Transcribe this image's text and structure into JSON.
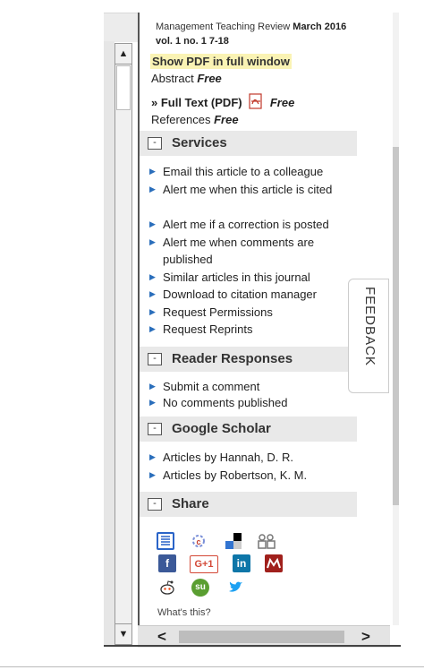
{
  "citation": {
    "journal": "Management Teaching Review",
    "date": "March 2016",
    "vol": "vol. 1 no. 1 7-18"
  },
  "pdf_window_link": "Show PDF in full window",
  "abstract": {
    "label": "Abstract",
    "free": "Free"
  },
  "fulltext": {
    "label": "» Full Text (PDF)",
    "free": "Free"
  },
  "references": {
    "label": "References",
    "free": "Free"
  },
  "services": {
    "title": "Services",
    "items": [
      "Email this article to a colleague",
      "Alert me when this article is cited",
      "Alert me if a correction is posted",
      "Alert me when comments are published",
      "Similar articles in this journal",
      "Download to citation manager",
      "Request Permissions",
      "Request Reprints"
    ]
  },
  "reader_responses": {
    "title": "Reader Responses",
    "items": [
      "Submit a comment",
      "No comments published"
    ]
  },
  "google_scholar": {
    "title": "Google Scholar",
    "items": [
      "Articles by Hannah, D. R.",
      "Articles by Robertson, K. M."
    ]
  },
  "share": {
    "title": "Share",
    "icons": [
      "citeulike-icon",
      "connotea-icon",
      "delicious-icon",
      "digg-icon",
      "facebook-icon",
      "google-plus-icon",
      "linkedin-icon",
      "mendeley-icon",
      "reddit-icon",
      "stumbleupon-icon",
      "twitter-icon"
    ],
    "gplus_label": "G+1",
    "linkedin_label": "in",
    "facebook_label": "f",
    "stumble_label": "su",
    "whats_this": "What's this?"
  },
  "feedback_label": "FEEDBACK",
  "toggle_symbol": "-",
  "colors": {
    "highlight": "#faf3b4",
    "section_bg": "#e9e9e9",
    "bullet": "#2a6ebb"
  }
}
